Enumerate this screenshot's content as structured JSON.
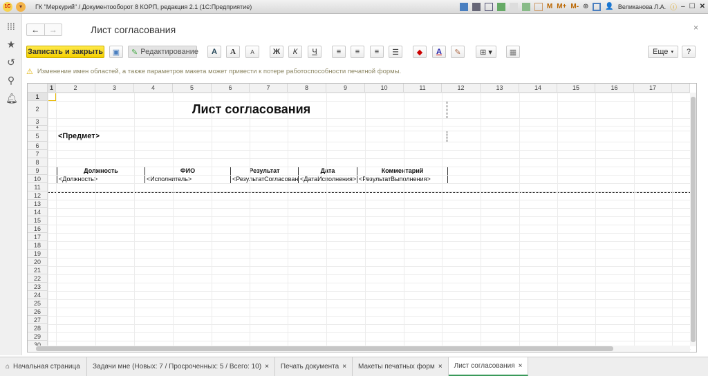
{
  "window": {
    "title": "ГК \"Меркурий\" / Документооборот 8 КОРП, редакция 2.1  (1С:Предприятие)",
    "logo": "1С",
    "user": "Великанова Л.А.",
    "memory": [
      "M",
      "M+",
      "M-"
    ]
  },
  "form": {
    "title": "Лист согласования",
    "close": "×",
    "back": "←",
    "forward": "→"
  },
  "toolbar": {
    "save_close": "Записать и закрыть",
    "edit_mode": "Редактирование",
    "bold": "Ж",
    "italic": "К",
    "underline": "Ч",
    "font": "A",
    "font_up": "A",
    "font_down": "A",
    "text_color": "A",
    "more": "Еще",
    "help": "?"
  },
  "warning": "Изменение имен областей, а также параметров макета может привести к потере работоспособности печатной формы.",
  "sheet": {
    "columns": [
      "1",
      "2",
      "3",
      "4",
      "5",
      "6",
      "7",
      "8",
      "9",
      "10",
      "11",
      "12",
      "13",
      "14",
      "15",
      "16",
      "17"
    ],
    "rows": [
      "1",
      "2",
      "3",
      "4",
      "5",
      "6",
      "7",
      "8",
      "9",
      "10",
      "11",
      "12",
      "13",
      "14",
      "15",
      "16",
      "17",
      "18",
      "19",
      "20",
      "21",
      "22",
      "23",
      "24",
      "25",
      "26",
      "27",
      "28",
      "29",
      "30"
    ],
    "heading": "Лист согласования",
    "subject": "<Предмет>",
    "table_headers": [
      "Должность",
      "ФИО",
      "Результат",
      "Дата",
      "Комментарий"
    ],
    "table_values": [
      "<Должность>",
      "<Исполнитель>",
      "<РезультатСогласования>",
      "<ДатаИсполнения>",
      "<РезультатВыполнения>"
    ]
  },
  "tabs": [
    {
      "label": "Начальная страница"
    },
    {
      "label": "Задачи мне (Новых: 7 / Просроченных: 5 / Всего: 10)",
      "close": "×"
    },
    {
      "label": "Печать документа",
      "close": "×"
    },
    {
      "label": "Макеты печатных форм",
      "close": "×"
    },
    {
      "label": "Лист согласования",
      "close": "×",
      "active": true
    }
  ]
}
